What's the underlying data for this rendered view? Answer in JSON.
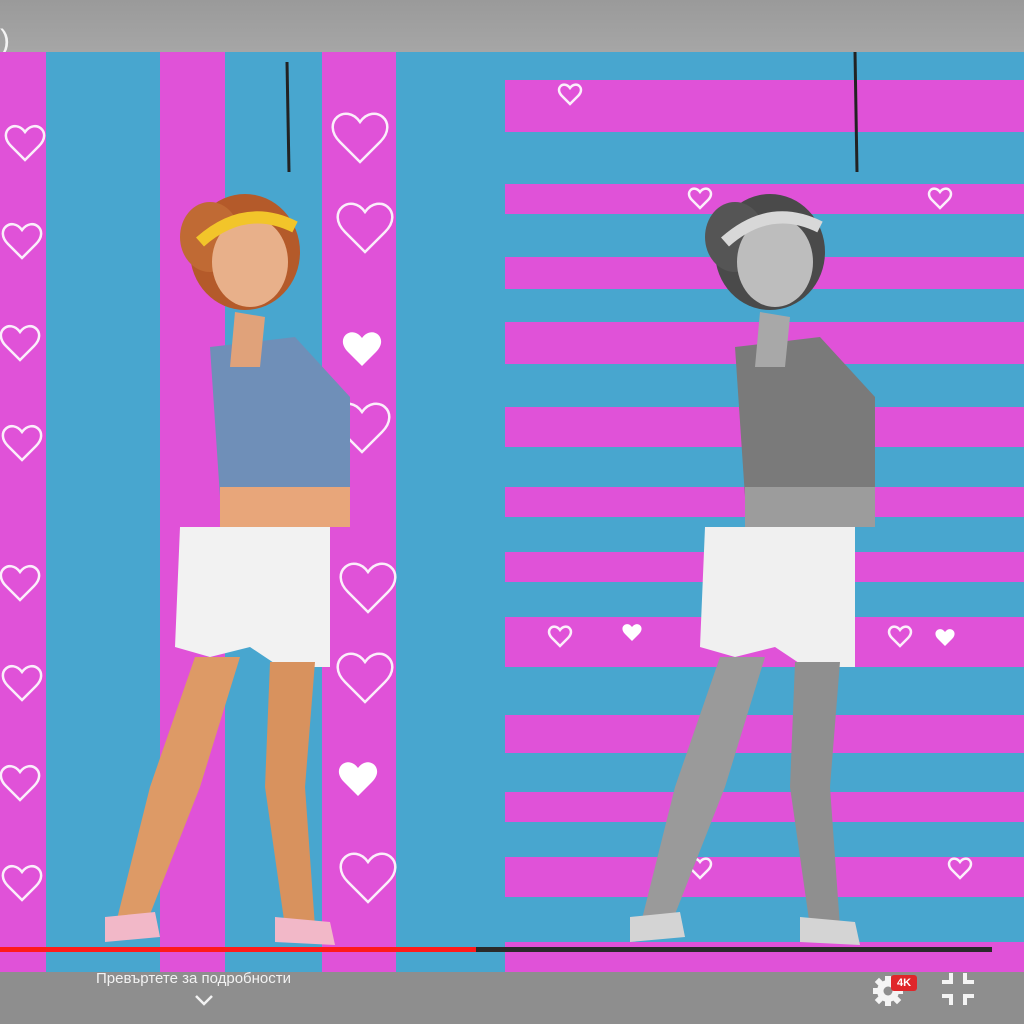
{
  "top": {
    "corner_text": ")"
  },
  "player": {
    "hint_text": "Превъртете за подробности",
    "quality_badge": "4K",
    "progress_fraction": 0.48,
    "icons": {
      "hint": "chevron-down-icon",
      "settings": "gear-icon",
      "fullscreen": "exit-fullscreen-icon"
    }
  },
  "colors": {
    "pink": "#e052d8",
    "blue": "#48a6cf",
    "progress": "#ff1a1a",
    "badge": "#e0262a"
  }
}
